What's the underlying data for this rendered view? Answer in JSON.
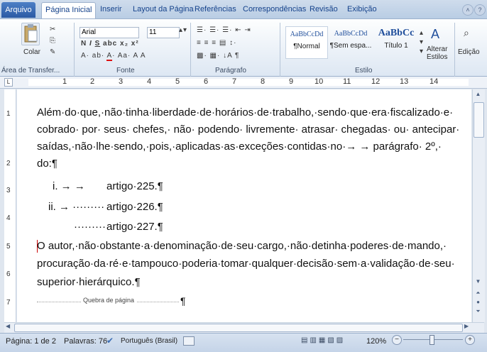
{
  "tabs": [
    {
      "label": "Arquivo"
    },
    {
      "label": "Página Inicial"
    },
    {
      "label": "Inserir"
    },
    {
      "label": "Layout da Página"
    },
    {
      "label": "Referências"
    },
    {
      "label": "Correspondências"
    },
    {
      "label": "Revisão"
    },
    {
      "label": "Exibição"
    }
  ],
  "ribbon": {
    "clipboard": {
      "paste_label": "Colar",
      "group_label": "Área de Transfer..."
    },
    "font": {
      "name": "Arial",
      "size": "11",
      "group_label": "Fonte"
    },
    "paragraph": {
      "group_label": "Parágrafo"
    },
    "styles": {
      "items": [
        {
          "sample": "AaBbCcDd",
          "name": "¶Normal"
        },
        {
          "sample": "AaBbCcDd",
          "name": "¶Sem espa..."
        },
        {
          "sample": "AaBbCc",
          "name": "Título 1"
        }
      ],
      "change_label": "Alterar Estilos",
      "group_label": "Estilo"
    },
    "editing": {
      "label": "Edição"
    }
  },
  "ruler": {
    "numbers": [
      "1",
      "2",
      "3",
      "4",
      "5",
      "6",
      "7",
      "8",
      "9",
      "10",
      "11",
      "12",
      "13",
      "14"
    ]
  },
  "vruler": {
    "numbers": [
      "1",
      "2",
      "3",
      "4",
      "5",
      "6",
      "7"
    ]
  },
  "document": {
    "p1": [
      "Além·do·que,·não·tinha·liberdade·de·horários·de·trabalho,·sendo·que·era·fiscalizado·e·",
      "cobrado· por· seus· chefes,· não· podendo· livremente· atrasar· chegadas· ou· antecipar·",
      "saídas,·não·lhe·sendo,·pois,·aplicadas·as·exceções·contidas·no·→  →   parágrafo· 2º,·",
      "do:¶"
    ],
    "list": [
      {
        "marker": "i. →  →",
        "text": "artigo·225.¶"
      },
      {
        "marker": "ii. →  ·········",
        "text": "artigo·226.¶"
      },
      {
        "marker": "·········",
        "text": "artigo·227.¶"
      }
    ],
    "p2": [
      "O autor,·não·obstante·a·denominação·de·seu·cargo,·não·detinha·poderes·de·mando,·",
      "procuração·da·ré·e·tampouco·poderia·tomar·qualquer·decisão·sem·a·validação·de·seu·",
      "superior·hierárquico.¶"
    ],
    "page_break": "Quebra de página",
    "page_break_mark": "¶"
  },
  "status": {
    "page": "Página: 1 de 2",
    "words": "Palavras: 76",
    "language": "Português (Brasil)",
    "zoom": "120%"
  }
}
